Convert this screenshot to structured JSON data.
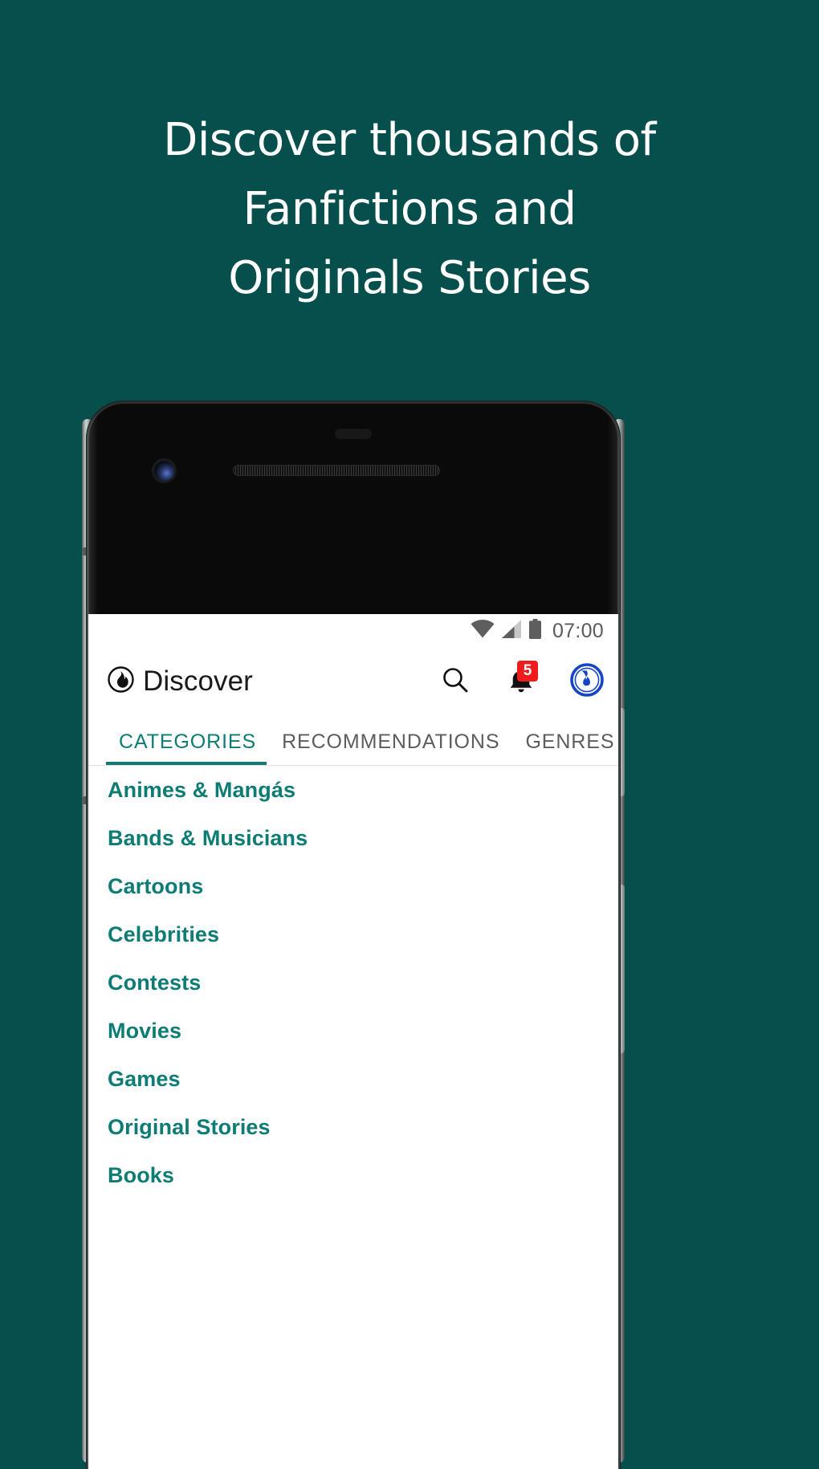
{
  "theme": {
    "background": "#064f4c",
    "accent": "#0c7c74",
    "badge": "#f01b1b",
    "avatar_blue": "#1545c4"
  },
  "promo": {
    "headline_lines": [
      "Discover thousands of",
      "Fanfictions and",
      "Originals Stories"
    ]
  },
  "phone": {
    "status_bar": {
      "time": "07:00",
      "icons": [
        "wifi-icon",
        "cell-signal-icon",
        "battery-icon"
      ]
    },
    "app_bar": {
      "logo_icon": "flame-circle-icon",
      "title": "Discover",
      "actions": [
        {
          "name": "search-icon",
          "label": "Search"
        },
        {
          "name": "notifications-bell-icon",
          "label": "Notifications",
          "badge": "5"
        },
        {
          "name": "profile-avatar-icon",
          "label": "Profile"
        }
      ]
    },
    "tabs": {
      "active_index": 0,
      "items": [
        {
          "label": "CATEGORIES"
        },
        {
          "label": "RECOMMENDATIONS"
        },
        {
          "label": "GENRES"
        }
      ]
    },
    "categories": [
      {
        "label": "Animes & Mangás"
      },
      {
        "label": "Bands & Musicians"
      },
      {
        "label": "Cartoons"
      },
      {
        "label": "Celebrities"
      },
      {
        "label": "Contests"
      },
      {
        "label": "Movies"
      },
      {
        "label": "Games"
      },
      {
        "label": "Original Stories"
      },
      {
        "label": "Books"
      }
    ]
  }
}
